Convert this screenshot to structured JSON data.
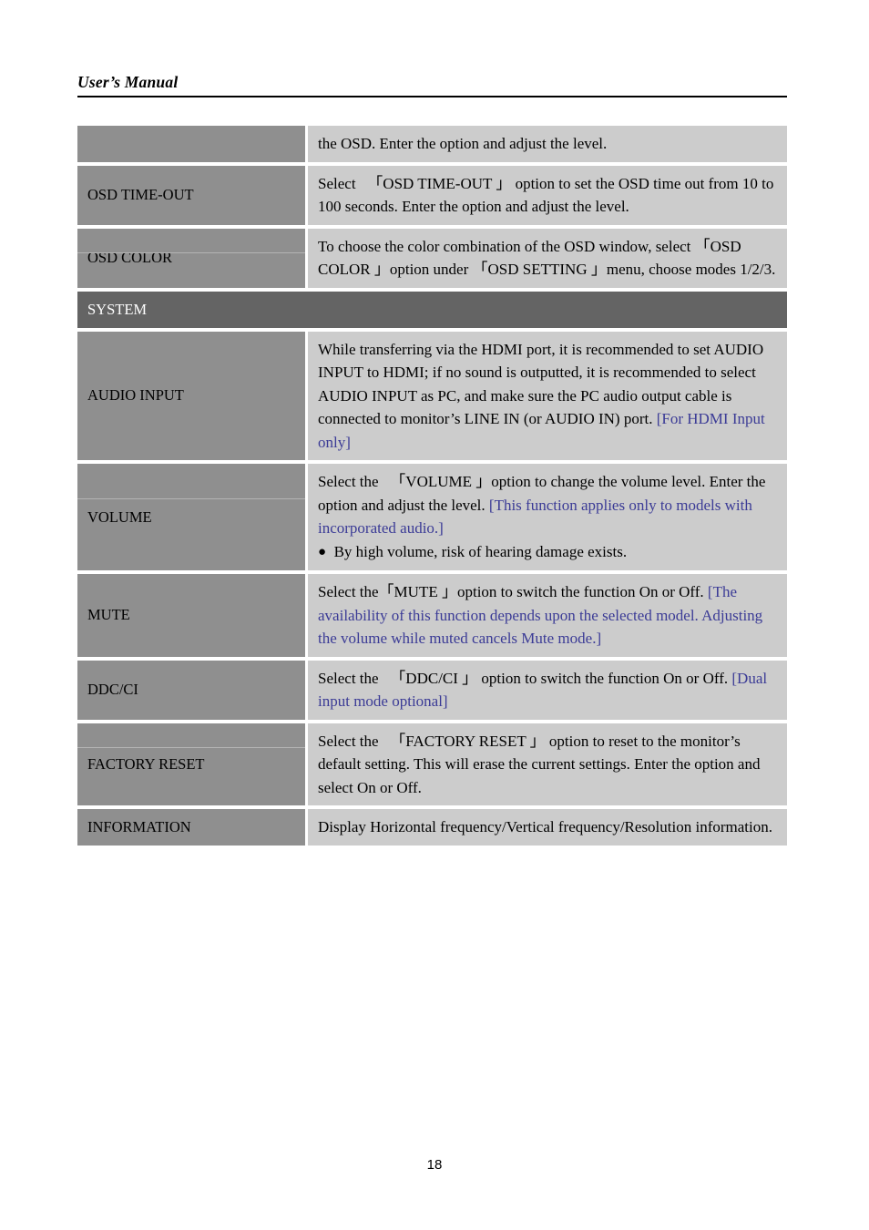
{
  "header": {
    "title": "User’s Manual"
  },
  "footer": {
    "page_number": "18"
  },
  "colors": {
    "label_cell_bg": "#8f8f8f",
    "desc_cell_bg": "#cccccc",
    "section_header_bg": "#646464",
    "section_header_text": "#ffffff",
    "note_blue": "#3b3b96",
    "page_bg": "#ffffff"
  },
  "table": {
    "rows": [
      {
        "label": "",
        "desc_parts": [
          {
            "text": "the OSD. Enter the option and adjust the level.",
            "style": "normal"
          }
        ]
      },
      {
        "label": "OSD TIME-OUT",
        "desc_parts": [
          {
            "text": "Select 　「OSD TIME-OUT 」 option to set the OSD time out from 10 to 100 seconds. Enter the option and adjust the level.",
            "style": "normal"
          }
        ]
      },
      {
        "label": "OSD COLOR",
        "desc_parts": [
          {
            "text": "To choose the color combination of the OSD window, select 「OSD COLOR 」option under 「OSD SETTING 」menu, choose modes 1/2/3.",
            "style": "normal"
          }
        ]
      }
    ],
    "section_header": "SYSTEM",
    "system_rows": [
      {
        "label": "AUDIO INPUT",
        "desc_parts": [
          {
            "text": "While transferring via the HDMI port, it is recommended to set AUDIO INPUT to HDMI; if no sound is outputted, it is recommended to select AUDIO INPUT as PC, and make sure the PC audio output cable is connected to monitor’s LINE IN (or AUDIO IN) port. ",
            "style": "normal"
          },
          {
            "text": "[For HDMI Input only]",
            "style": "blue"
          }
        ]
      },
      {
        "label": "VOLUME",
        "desc_parts": [
          {
            "text": "Select the 　「VOLUME 」option to change the volume level. Enter the option and adjust the level. ",
            "style": "normal"
          },
          {
            "text": "[This function applies only to models with incorporated audio.]",
            "style": "blue"
          }
        ],
        "bullet": "●",
        "bullet_text": "By high volume, risk of hearing damage exists."
      },
      {
        "label": "MUTE",
        "desc_parts": [
          {
            "text": "Select the「MUTE 」option to switch the function On or Off. ",
            "style": "normal"
          },
          {
            "text": "[The availability of this function depends upon the selected model. Adjusting the volume while muted cancels Mute mode.]",
            "style": "blue"
          }
        ]
      },
      {
        "label": "DDC/CI",
        "desc_parts": [
          {
            "text": "Select the 　「DDC/CI 」 option to switch the function On or Off. ",
            "style": "normal"
          },
          {
            "text": "[Dual input mode optional]",
            "style": "blue"
          }
        ]
      },
      {
        "label": "FACTORY RESET",
        "desc_parts": [
          {
            "text": "Select the 　「FACTORY RESET 」 option to reset to the monitor’s default setting. This will erase the current settings. Enter the option and select On or Off.",
            "style": "normal"
          }
        ]
      },
      {
        "label": "INFORMATION",
        "desc_parts": [
          {
            "text": "Display Horizontal frequency/Vertical frequency/Resolution information.",
            "style": "normal"
          }
        ]
      }
    ]
  }
}
